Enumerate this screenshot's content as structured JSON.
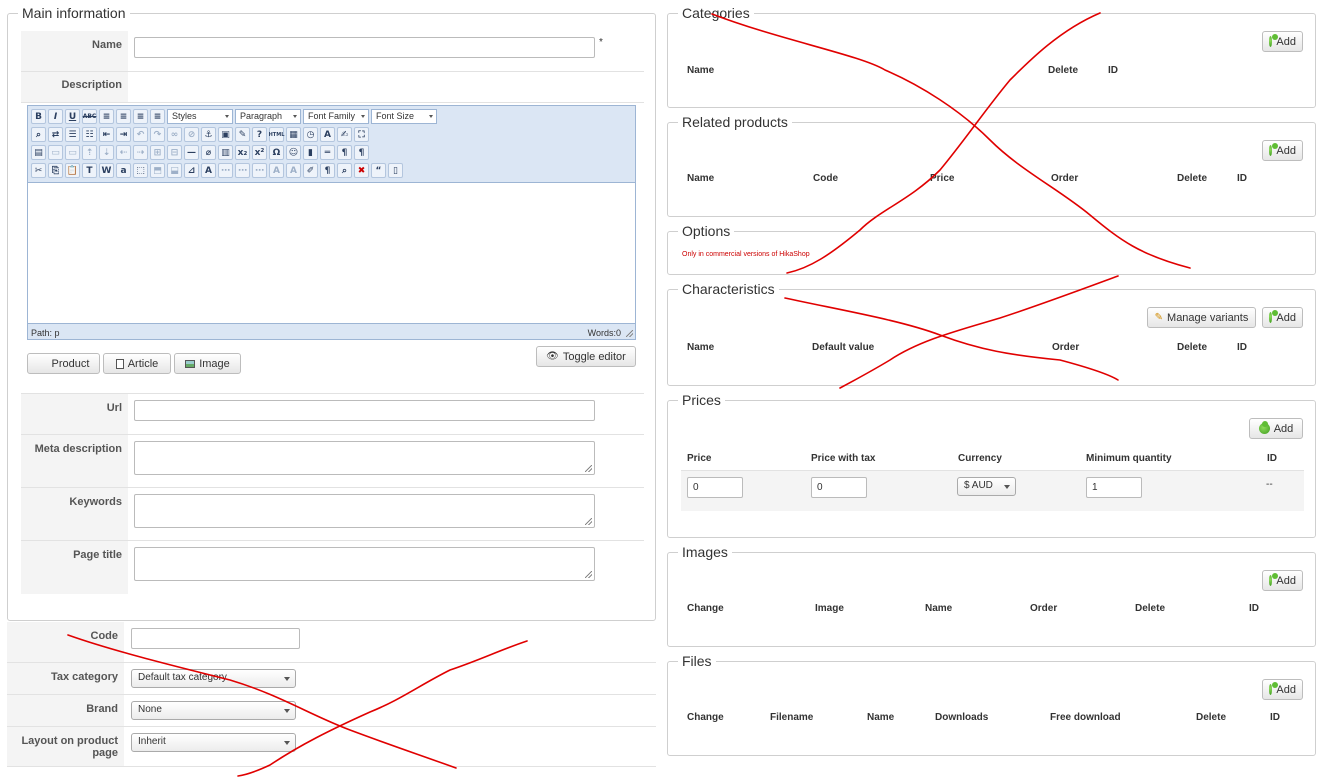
{
  "main": {
    "legend": "Main information",
    "name_label": "Name",
    "required_mark": "*",
    "description_label": "Description",
    "url_label": "Url",
    "meta_description_label": "Meta description",
    "keywords_label": "Keywords",
    "page_title_label": "Page title"
  },
  "editor": {
    "styles": "Styles",
    "paragraph": "Paragraph",
    "font_family": "Font Family",
    "font_size": "Font Size",
    "path": "Path: p",
    "words": "Words:0",
    "insert_buttons": [
      "Product",
      "Article",
      "Image"
    ],
    "toggle_label": "Toggle editor"
  },
  "extra": {
    "code_label": "Code",
    "tax_label": "Tax category",
    "tax_value": "Default tax category",
    "brand_label": "Brand",
    "brand_value": "None",
    "layout_label": "Layout on product page",
    "layout_value": "Inherit"
  },
  "categories": {
    "legend": "Categories",
    "add": "Add",
    "headers": [
      "Name",
      "Delete",
      "ID"
    ]
  },
  "related": {
    "legend": "Related products",
    "add": "Add",
    "headers": [
      "Name",
      "Code",
      "Price",
      "Order",
      "Delete",
      "ID"
    ]
  },
  "options": {
    "legend": "Options",
    "note": "Only in commercial versions of HikaShop"
  },
  "characteristics": {
    "legend": "Characteristics",
    "manage": "Manage variants",
    "add": "Add",
    "headers": [
      "Name",
      "Default value",
      "Order",
      "Delete",
      "ID"
    ]
  },
  "prices": {
    "legend": "Prices",
    "add": "Add",
    "headers": [
      "Price",
      "Price with tax",
      "Currency",
      "Minimum quantity",
      "ID"
    ],
    "row": {
      "price": "0",
      "price_with_tax": "0",
      "currency": "$ AUD",
      "min_qty": "1",
      "id": "--"
    }
  },
  "images": {
    "legend": "Images",
    "add": "Add",
    "headers": [
      "Change",
      "Image",
      "Name",
      "Order",
      "Delete",
      "ID"
    ]
  },
  "files": {
    "legend": "Files",
    "add": "Add",
    "headers": [
      "Change",
      "Filename",
      "Name",
      "Downloads",
      "Free download",
      "Delete",
      "ID"
    ]
  },
  "colors": {
    "annotation": "#e00000",
    "editor_bg": "#dbe6f4",
    "label_bg": "#f4f4f4"
  }
}
